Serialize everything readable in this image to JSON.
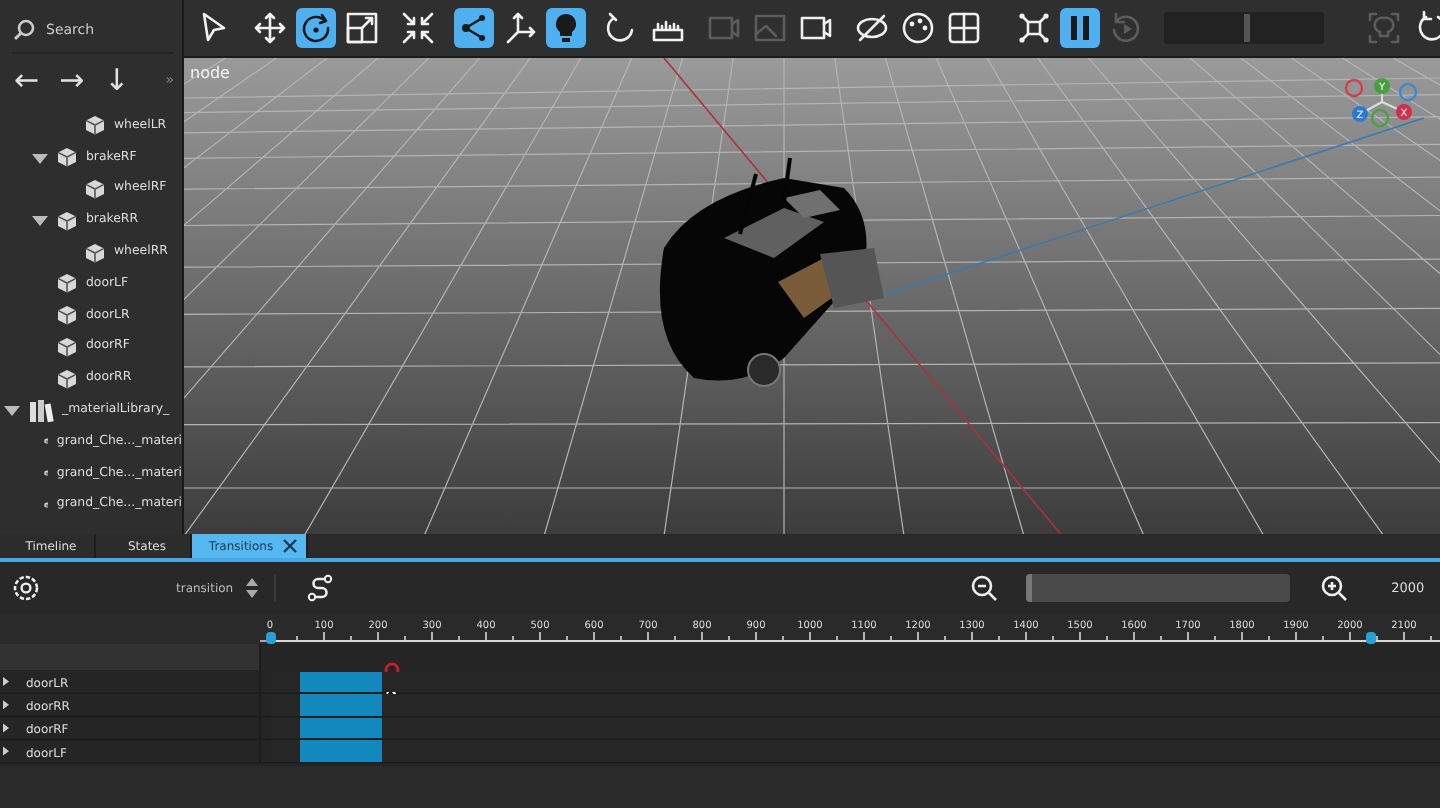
{
  "search": {
    "placeholder": "Search"
  },
  "nav_arrows": [
    "←",
    "→",
    "↓"
  ],
  "panel_more": "»",
  "tree": [
    {
      "children": [
        {
          "children": [
            {
              "label": "wheelLR",
              "kind": "mesh"
            }
          ]
        },
        {
          "label": "brakeRF",
          "kind": "mesh",
          "expanded": true,
          "children": [
            {
              "label": "wheelRF",
              "kind": "mesh"
            }
          ]
        },
        {
          "label": "brakeRR",
          "kind": "mesh",
          "expanded": true,
          "children": [
            {
              "label": "wheelRR",
              "kind": "mesh"
            }
          ]
        },
        {
          "label": "doorLF",
          "kind": "mesh"
        },
        {
          "label": "doorLR",
          "kind": "mesh"
        },
        {
          "label": "doorRF",
          "kind": "mesh"
        },
        {
          "label": "doorRR",
          "kind": "mesh"
        }
      ]
    },
    {
      "label": "_materialLibrary_",
      "kind": "library",
      "expanded": true,
      "children": [
        {
          "label": "grand_Che..._materi",
          "kind": "material"
        },
        {
          "label": "grand_Che..._materi",
          "kind": "material"
        },
        {
          "label": "grand_Che..._materi",
          "kind": "material"
        }
      ]
    }
  ],
  "toolbar": {
    "groups": [
      [
        {
          "kind": "select",
          "selected": false,
          "disabled": false
        }
      ],
      [
        {
          "kind": "move",
          "selected": false,
          "disabled": false
        },
        {
          "kind": "rotate",
          "selected": true,
          "disabled": false
        },
        {
          "kind": "scale",
          "selected": false,
          "disabled": false
        }
      ],
      [
        {
          "kind": "collapse",
          "selected": false,
          "disabled": false
        }
      ],
      [
        {
          "kind": "nodes",
          "selected": true,
          "disabled": false
        },
        {
          "kind": "axes",
          "selected": false,
          "disabled": false
        },
        {
          "kind": "bulb",
          "selected": true,
          "disabled": false
        }
      ],
      [
        {
          "kind": "hook",
          "selected": false,
          "disabled": false
        },
        {
          "kind": "ruler",
          "selected": false,
          "disabled": false
        }
      ],
      [
        {
          "kind": "camera",
          "selected": false,
          "disabled": true
        },
        {
          "kind": "image",
          "selected": false,
          "disabled": true
        },
        {
          "kind": "camera",
          "selected": false,
          "disabled": false
        }
      ],
      [
        {
          "kind": "hide",
          "selected": false,
          "disabled": false
        },
        {
          "kind": "palette",
          "selected": false,
          "disabled": false
        },
        {
          "kind": "grid",
          "selected": false,
          "disabled": false
        }
      ]
    ],
    "right": [
      {
        "kind": "network",
        "selected": false,
        "disabled": false
      },
      {
        "kind": "pause",
        "selected": true,
        "disabled": false
      },
      {
        "kind": "replay",
        "selected": false,
        "disabled": true
      }
    ],
    "slider": {
      "level": 0.5
    },
    "end": [
      {
        "kind": "focus",
        "selected": false,
        "disabled": true
      },
      {
        "kind": "refresh",
        "selected": false,
        "disabled": false
      }
    ]
  },
  "viewport": {
    "label": "node",
    "gizmo": {
      "x": "X",
      "y": "Y",
      "z": "Z"
    }
  },
  "tabs": [
    {
      "label": "Timeline",
      "selected": false,
      "closable": false
    },
    {
      "label": "States",
      "selected": false,
      "closable": false
    },
    {
      "label": "Transitions",
      "selected": true,
      "closable": true
    }
  ],
  "controls": {
    "transition": {
      "value": "transition"
    },
    "end_time": "2000"
  },
  "timeline": {
    "ruler": {
      "labels": [
        "0",
        "100",
        "200",
        "300",
        "400",
        "500",
        "600",
        "700",
        "800",
        "900",
        "1000",
        "1100",
        "1200",
        "1300",
        "1400",
        "1500",
        "1600",
        "1700",
        "1800",
        "1900",
        "2000",
        "2100"
      ],
      "start_marker": {
        "level": 0
      },
      "end_marker": {
        "level": 0.93
      }
    },
    "tracks": [
      {
        "label": "doorLR",
        "expanded": false,
        "clip": {
          "start": {
            "level": 0.026
          },
          "end": {
            "level": 0.095
          }
        }
      },
      {
        "label": "doorRR",
        "expanded": false,
        "clip": {
          "start": {
            "level": 0.026
          },
          "end": {
            "level": 0.095
          }
        }
      },
      {
        "label": "doorRF",
        "expanded": false,
        "clip": {
          "start": {
            "level": 0.026
          },
          "end": {
            "level": 0.095
          }
        }
      },
      {
        "label": "doorLF",
        "expanded": false,
        "clip": {
          "start": {
            "level": 0.026
          },
          "end": {
            "level": 0.095
          }
        }
      }
    ]
  }
}
